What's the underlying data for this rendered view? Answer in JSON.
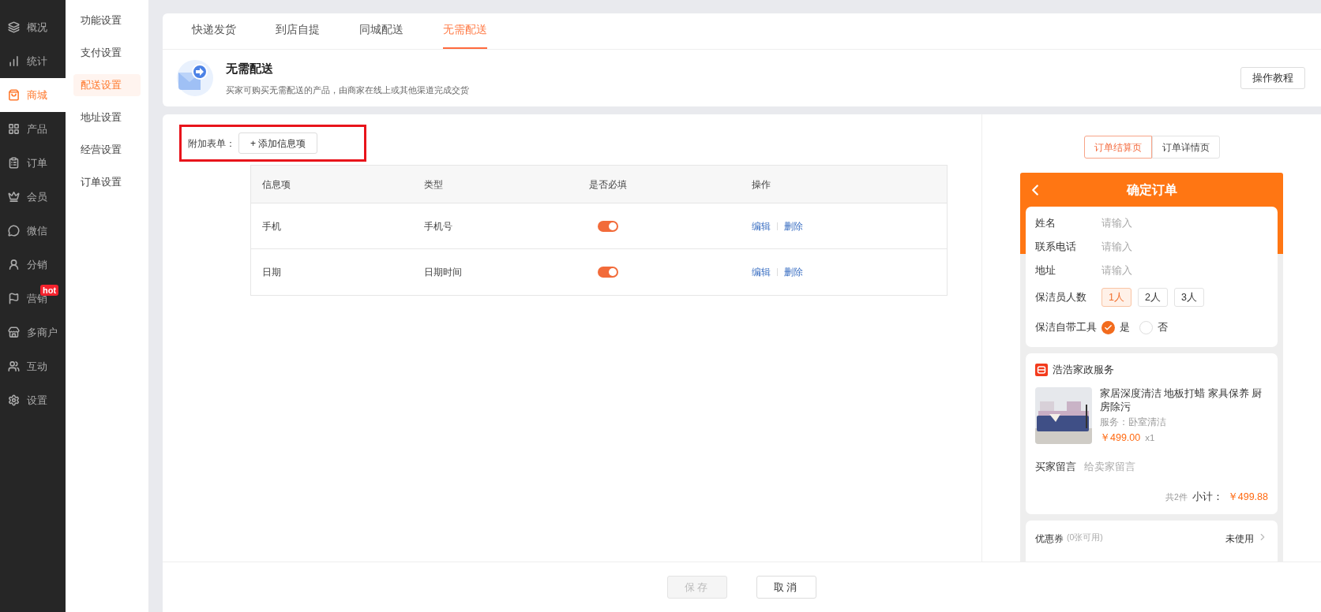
{
  "nav": [
    {
      "label": "概况",
      "selected": false
    },
    {
      "label": "统计",
      "selected": false
    },
    {
      "label": "商城",
      "selected": true
    },
    {
      "label": "产品",
      "selected": false
    },
    {
      "label": "订单",
      "selected": false
    },
    {
      "label": "会员",
      "selected": false
    },
    {
      "label": "微信",
      "selected": false
    },
    {
      "label": "分销",
      "selected": false
    },
    {
      "label": "营销",
      "selected": false,
      "badge": "hot"
    },
    {
      "label": "多商户",
      "selected": false
    },
    {
      "label": "互动",
      "selected": false
    },
    {
      "label": "设置",
      "selected": false
    }
  ],
  "submenu": [
    {
      "label": "功能设置",
      "selected": false
    },
    {
      "label": "支付设置",
      "selected": false
    },
    {
      "label": "配送设置",
      "selected": true
    },
    {
      "label": "地址设置",
      "selected": false
    },
    {
      "label": "经营设置",
      "selected": false
    },
    {
      "label": "订单设置",
      "selected": false
    }
  ],
  "tabs": [
    {
      "label": "快递发货",
      "selected": false
    },
    {
      "label": "到店自提",
      "selected": false
    },
    {
      "label": "同城配送",
      "selected": false
    },
    {
      "label": "无需配送",
      "selected": true
    }
  ],
  "header": {
    "title": "无需配送",
    "description": "买家可购买无需配送的产品，由商家在线上或其他渠道完成交货",
    "tutorial_button": "操作教程"
  },
  "form": {
    "label": "附加表单：",
    "add_button": "+ 添加信息项"
  },
  "table": {
    "columns": [
      "信息项",
      "类型",
      "是否必填",
      "操作"
    ],
    "rows": [
      {
        "name": "手机",
        "type": "手机号",
        "required": true,
        "actions": [
          "编辑",
          "删除"
        ]
      },
      {
        "name": "日期",
        "type": "日期时间",
        "required": true,
        "actions": [
          "编辑",
          "删除"
        ]
      }
    ]
  },
  "preview": {
    "tabs": [
      {
        "label": "订单结算页",
        "selected": true
      },
      {
        "label": "订单详情页",
        "selected": false
      }
    ],
    "title": "确定订单",
    "fields": [
      {
        "label": "姓名",
        "placeholder": "请输入"
      },
      {
        "label": "联系电话",
        "placeholder": "请输入"
      },
      {
        "label": "地址",
        "placeholder": "请输入"
      }
    ],
    "cleaners": {
      "label": "保洁员人数",
      "options": [
        {
          "label": "1人",
          "selected": true
        },
        {
          "label": "2人",
          "selected": false
        },
        {
          "label": "3人",
          "selected": false
        }
      ]
    },
    "tools": {
      "label": "保洁自带工具",
      "options": [
        {
          "label": "是",
          "selected": true
        },
        {
          "label": "否",
          "selected": false
        }
      ]
    },
    "shop": "浩浩家政服务",
    "product": {
      "kind": "picture",
      "name": "家居深度清洁 地板打蜡 家具保养 厨房除污",
      "service": "服务：卧室清洁",
      "price": "￥499.00",
      "qty": "x1"
    },
    "message": {
      "label": "买家留言",
      "placeholder": "给卖家留言"
    },
    "count": "共2件",
    "subtotal_label": "小计：",
    "subtotal": "￥499.88",
    "coupon": {
      "label": "优惠券",
      "note": "(0张可用)",
      "value": "未使用"
    }
  },
  "footer": {
    "buttons": [
      {
        "label": "保存",
        "disabled": true
      },
      {
        "label": "取消",
        "disabled": false
      }
    ]
  }
}
